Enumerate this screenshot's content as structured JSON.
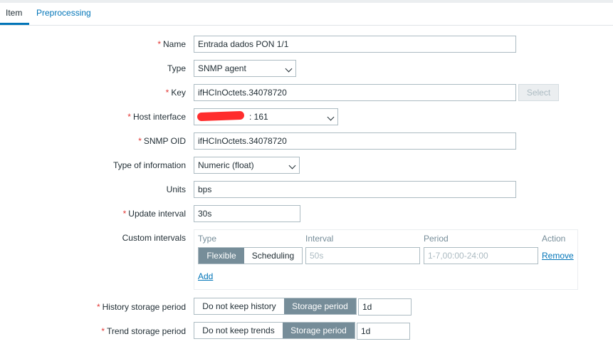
{
  "tabs": [
    {
      "label": "Item",
      "active": true
    },
    {
      "label": "Preprocessing",
      "active": false
    }
  ],
  "form": {
    "name": {
      "label": "Name",
      "value": "Entrada dados PON 1/1"
    },
    "type": {
      "label": "Type",
      "value": "SNMP agent"
    },
    "key": {
      "label": "Key",
      "value": "ifHCInOctets.34078720",
      "select_label": "Select"
    },
    "host_interface": {
      "label": "Host interface",
      "value": ": 161"
    },
    "snmp_oid": {
      "label": "SNMP OID",
      "value": "ifHCInOctets.34078720"
    },
    "type_of_information": {
      "label": "Type of information",
      "value": "Numeric (float)"
    },
    "units": {
      "label": "Units",
      "value": "bps"
    },
    "update_interval": {
      "label": "Update interval",
      "value": "30s"
    },
    "custom_intervals": {
      "label": "Custom intervals",
      "headers": {
        "type": "Type",
        "interval": "Interval",
        "period": "Period",
        "action": "Action"
      },
      "row": {
        "flexible": "Flexible",
        "scheduling": "Scheduling",
        "interval_placeholder": "50s",
        "period_placeholder": "1-7,00:00-24:00",
        "remove": "Remove"
      },
      "add": "Add"
    },
    "history": {
      "label": "History storage period",
      "option_off": "Do not keep history",
      "option_on": "Storage period",
      "value": "1d"
    },
    "trend": {
      "label": "Trend storage period",
      "option_off": "Do not keep trends",
      "option_on": "Storage period",
      "value": "1d"
    }
  },
  "colors": {
    "accent": "#0275b8",
    "required": "#e33734",
    "segment_active": "#768d99"
  }
}
